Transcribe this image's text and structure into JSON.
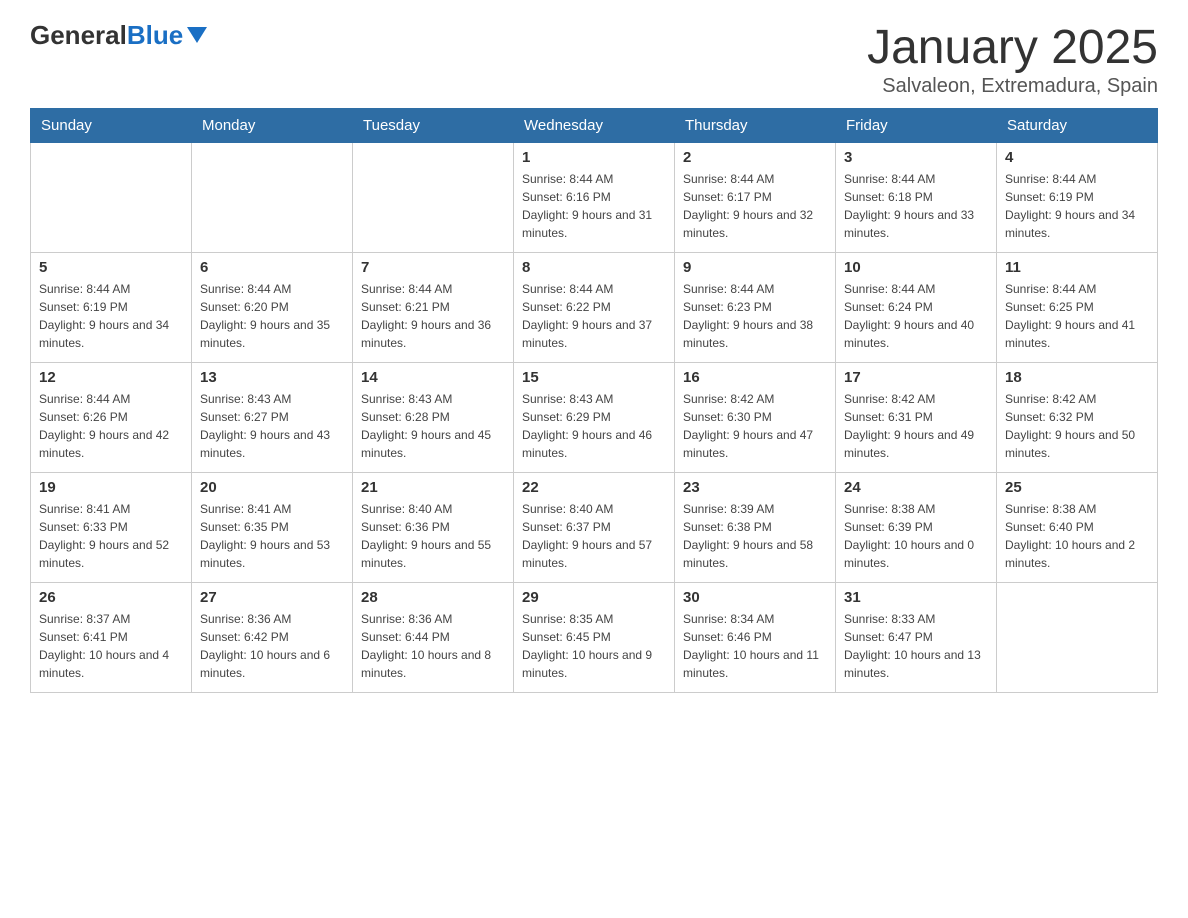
{
  "header": {
    "logo_general": "General",
    "logo_blue": "Blue",
    "title": "January 2025",
    "subtitle": "Salvaleon, Extremadura, Spain"
  },
  "days_of_week": [
    "Sunday",
    "Monday",
    "Tuesday",
    "Wednesday",
    "Thursday",
    "Friday",
    "Saturday"
  ],
  "weeks": [
    [
      {
        "day": "",
        "info": ""
      },
      {
        "day": "",
        "info": ""
      },
      {
        "day": "",
        "info": ""
      },
      {
        "day": "1",
        "info": "Sunrise: 8:44 AM\nSunset: 6:16 PM\nDaylight: 9 hours and 31 minutes."
      },
      {
        "day": "2",
        "info": "Sunrise: 8:44 AM\nSunset: 6:17 PM\nDaylight: 9 hours and 32 minutes."
      },
      {
        "day": "3",
        "info": "Sunrise: 8:44 AM\nSunset: 6:18 PM\nDaylight: 9 hours and 33 minutes."
      },
      {
        "day": "4",
        "info": "Sunrise: 8:44 AM\nSunset: 6:19 PM\nDaylight: 9 hours and 34 minutes."
      }
    ],
    [
      {
        "day": "5",
        "info": "Sunrise: 8:44 AM\nSunset: 6:19 PM\nDaylight: 9 hours and 34 minutes."
      },
      {
        "day": "6",
        "info": "Sunrise: 8:44 AM\nSunset: 6:20 PM\nDaylight: 9 hours and 35 minutes."
      },
      {
        "day": "7",
        "info": "Sunrise: 8:44 AM\nSunset: 6:21 PM\nDaylight: 9 hours and 36 minutes."
      },
      {
        "day": "8",
        "info": "Sunrise: 8:44 AM\nSunset: 6:22 PM\nDaylight: 9 hours and 37 minutes."
      },
      {
        "day": "9",
        "info": "Sunrise: 8:44 AM\nSunset: 6:23 PM\nDaylight: 9 hours and 38 minutes."
      },
      {
        "day": "10",
        "info": "Sunrise: 8:44 AM\nSunset: 6:24 PM\nDaylight: 9 hours and 40 minutes."
      },
      {
        "day": "11",
        "info": "Sunrise: 8:44 AM\nSunset: 6:25 PM\nDaylight: 9 hours and 41 minutes."
      }
    ],
    [
      {
        "day": "12",
        "info": "Sunrise: 8:44 AM\nSunset: 6:26 PM\nDaylight: 9 hours and 42 minutes."
      },
      {
        "day": "13",
        "info": "Sunrise: 8:43 AM\nSunset: 6:27 PM\nDaylight: 9 hours and 43 minutes."
      },
      {
        "day": "14",
        "info": "Sunrise: 8:43 AM\nSunset: 6:28 PM\nDaylight: 9 hours and 45 minutes."
      },
      {
        "day": "15",
        "info": "Sunrise: 8:43 AM\nSunset: 6:29 PM\nDaylight: 9 hours and 46 minutes."
      },
      {
        "day": "16",
        "info": "Sunrise: 8:42 AM\nSunset: 6:30 PM\nDaylight: 9 hours and 47 minutes."
      },
      {
        "day": "17",
        "info": "Sunrise: 8:42 AM\nSunset: 6:31 PM\nDaylight: 9 hours and 49 minutes."
      },
      {
        "day": "18",
        "info": "Sunrise: 8:42 AM\nSunset: 6:32 PM\nDaylight: 9 hours and 50 minutes."
      }
    ],
    [
      {
        "day": "19",
        "info": "Sunrise: 8:41 AM\nSunset: 6:33 PM\nDaylight: 9 hours and 52 minutes."
      },
      {
        "day": "20",
        "info": "Sunrise: 8:41 AM\nSunset: 6:35 PM\nDaylight: 9 hours and 53 minutes."
      },
      {
        "day": "21",
        "info": "Sunrise: 8:40 AM\nSunset: 6:36 PM\nDaylight: 9 hours and 55 minutes."
      },
      {
        "day": "22",
        "info": "Sunrise: 8:40 AM\nSunset: 6:37 PM\nDaylight: 9 hours and 57 minutes."
      },
      {
        "day": "23",
        "info": "Sunrise: 8:39 AM\nSunset: 6:38 PM\nDaylight: 9 hours and 58 minutes."
      },
      {
        "day": "24",
        "info": "Sunrise: 8:38 AM\nSunset: 6:39 PM\nDaylight: 10 hours and 0 minutes."
      },
      {
        "day": "25",
        "info": "Sunrise: 8:38 AM\nSunset: 6:40 PM\nDaylight: 10 hours and 2 minutes."
      }
    ],
    [
      {
        "day": "26",
        "info": "Sunrise: 8:37 AM\nSunset: 6:41 PM\nDaylight: 10 hours and 4 minutes."
      },
      {
        "day": "27",
        "info": "Sunrise: 8:36 AM\nSunset: 6:42 PM\nDaylight: 10 hours and 6 minutes."
      },
      {
        "day": "28",
        "info": "Sunrise: 8:36 AM\nSunset: 6:44 PM\nDaylight: 10 hours and 8 minutes."
      },
      {
        "day": "29",
        "info": "Sunrise: 8:35 AM\nSunset: 6:45 PM\nDaylight: 10 hours and 9 minutes."
      },
      {
        "day": "30",
        "info": "Sunrise: 8:34 AM\nSunset: 6:46 PM\nDaylight: 10 hours and 11 minutes."
      },
      {
        "day": "31",
        "info": "Sunrise: 8:33 AM\nSunset: 6:47 PM\nDaylight: 10 hours and 13 minutes."
      },
      {
        "day": "",
        "info": ""
      }
    ]
  ]
}
